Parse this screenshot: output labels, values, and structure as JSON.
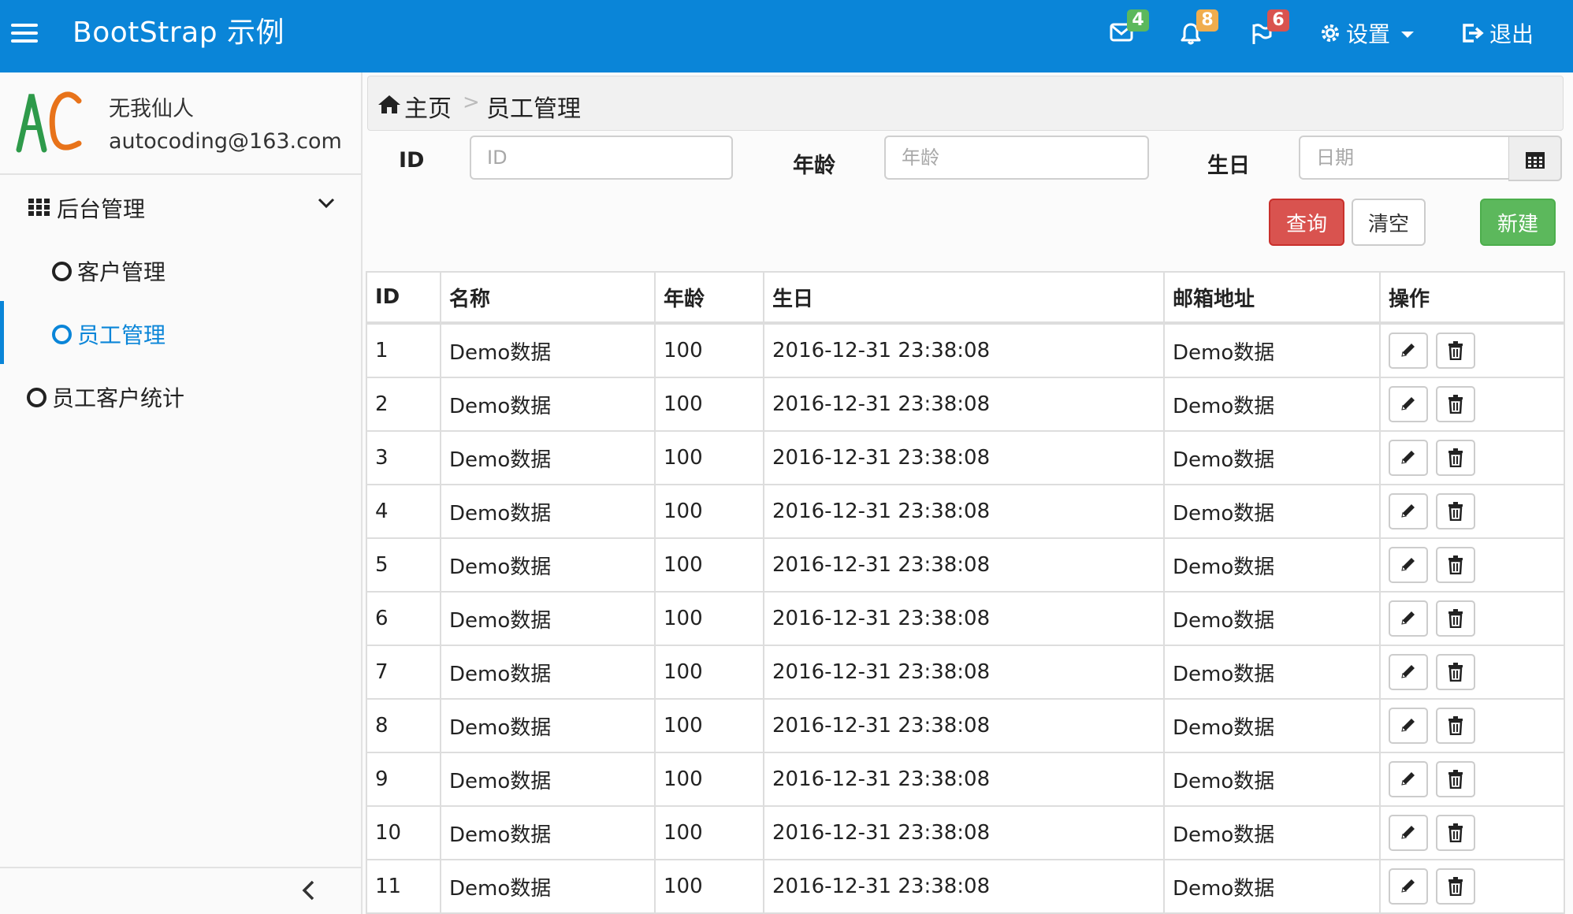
{
  "navbar": {
    "brand": "BootStrap 示例",
    "mail_count": "4",
    "bell_count": "8",
    "flag_count": "6",
    "settings_label": "设置",
    "logout_label": "退出",
    "colors": {
      "bar": "#0a85d8",
      "mail_badge": "#5cb85c",
      "bell_badge": "#f0ad4e",
      "flag_badge": "#d9534f"
    }
  },
  "sidebar": {
    "profile": {
      "name": "无我仙人",
      "email": "autocoding@163.com",
      "avatar_text": "AC"
    },
    "group_label": "后台管理",
    "items": [
      {
        "label": "客户管理",
        "active": false
      },
      {
        "label": "员工管理",
        "active": true
      },
      {
        "label": "员工客户统计",
        "active": false
      }
    ]
  },
  "breadcrumb": {
    "home": "主页",
    "separator": ">",
    "current": "员工管理"
  },
  "filters": {
    "id_label": "ID",
    "id_placeholder": "ID",
    "age_label": "年龄",
    "age_placeholder": "年龄",
    "birthday_label": "生日",
    "birthday_placeholder": "日期"
  },
  "buttons": {
    "query": "查询",
    "clear": "清空",
    "create": "新建"
  },
  "table": {
    "headers": [
      "ID",
      "名称",
      "年龄",
      "生日",
      "邮箱地址",
      "操作"
    ],
    "rows": [
      [
        "1",
        "Demo数据",
        "100",
        "2016-12-31 23:38:08",
        "Demo数据"
      ],
      [
        "2",
        "Demo数据",
        "100",
        "2016-12-31 23:38:08",
        "Demo数据"
      ],
      [
        "3",
        "Demo数据",
        "100",
        "2016-12-31 23:38:08",
        "Demo数据"
      ],
      [
        "4",
        "Demo数据",
        "100",
        "2016-12-31 23:38:08",
        "Demo数据"
      ],
      [
        "5",
        "Demo数据",
        "100",
        "2016-12-31 23:38:08",
        "Demo数据"
      ],
      [
        "6",
        "Demo数据",
        "100",
        "2016-12-31 23:38:08",
        "Demo数据"
      ],
      [
        "7",
        "Demo数据",
        "100",
        "2016-12-31 23:38:08",
        "Demo数据"
      ],
      [
        "8",
        "Demo数据",
        "100",
        "2016-12-31 23:38:08",
        "Demo数据"
      ],
      [
        "9",
        "Demo数据",
        "100",
        "2016-12-31 23:38:08",
        "Demo数据"
      ],
      [
        "10",
        "Demo数据",
        "100",
        "2016-12-31 23:38:08",
        "Demo数据"
      ],
      [
        "11",
        "Demo数据",
        "100",
        "2016-12-31 23:38:08",
        "Demo数据"
      ]
    ]
  }
}
